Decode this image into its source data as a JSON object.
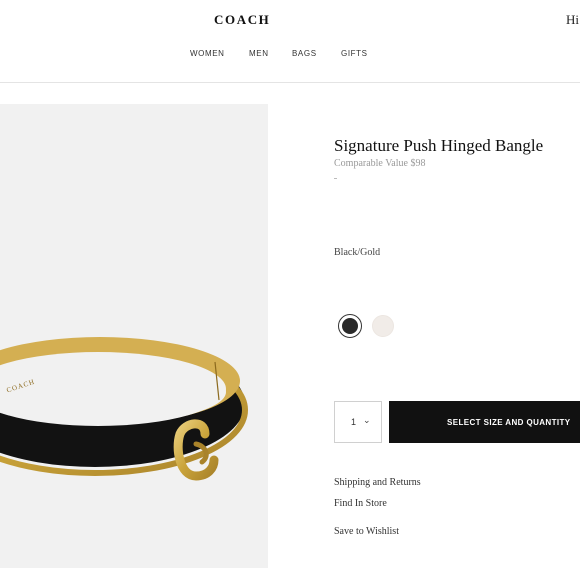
{
  "header": {
    "logo": "COACH",
    "greeting": "Hi",
    "nav": [
      "WOMEN",
      "MEN",
      "BAGS",
      "GIFTS"
    ]
  },
  "product": {
    "title": "Signature Push Hinged Bangle",
    "comparable_value": "Comparable Value $98",
    "color_name": "Black/Gold",
    "swatches": [
      {
        "name": "black",
        "color": "#2a2a2a",
        "selected": true
      },
      {
        "name": "cream",
        "color": "#f1ece8",
        "selected": false
      }
    ],
    "image_logo_text": "COACH"
  },
  "purchase": {
    "quantity": "1",
    "chevron": "⌄",
    "cta_label": "SELECT SIZE AND QUANTITY"
  },
  "links": {
    "shipping": "Shipping and Returns",
    "find_store": "Find In Store",
    "wishlist": "Save to Wishlist"
  },
  "colors": {
    "accent": "#111111",
    "gold": "#c9a33a",
    "enamel": "#121212",
    "image_bg": "#f1f1f1"
  }
}
